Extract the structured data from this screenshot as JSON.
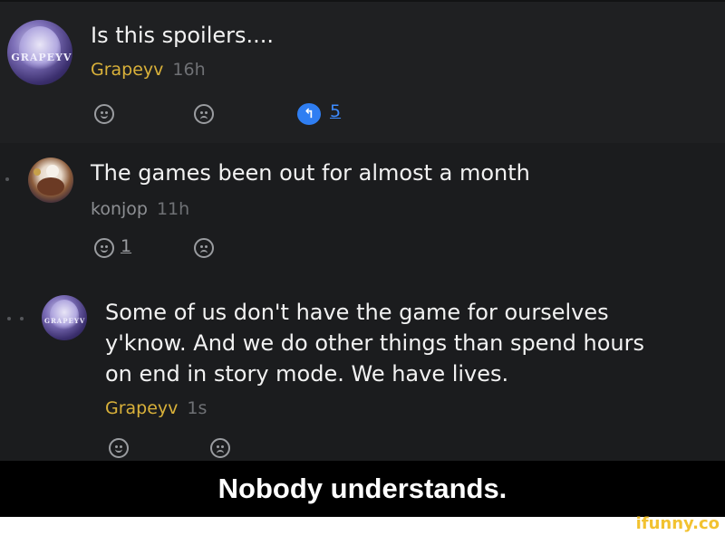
{
  "posts": [
    {
      "title": "Is this spoilers....",
      "author": "Grapeyv",
      "time": "16h",
      "avatar_text": "GRAPEYV",
      "reply_count": "5"
    },
    {
      "title": "The games been out for almost a month",
      "author": "konjop",
      "time": "11h",
      "like_count": "1"
    },
    {
      "title_lines": [
        "Some of us don't have the game for ourselves",
        "y'know. And we do other things than spend hours",
        "on end in story mode. We have lives."
      ],
      "author": "Grapeyv",
      "time": "1s",
      "avatar_text": "GRAPEYV"
    }
  ],
  "caption": "Nobody understands.",
  "watermark": "ifunny.co",
  "colors": {
    "background": "#1b1c1e",
    "author_gold": "#d9b13a",
    "reply_blue": "#2f7ef2",
    "watermark_yellow": "#f2c230"
  },
  "icons": [
    "smile-icon",
    "frown-icon",
    "reply-icon"
  ]
}
